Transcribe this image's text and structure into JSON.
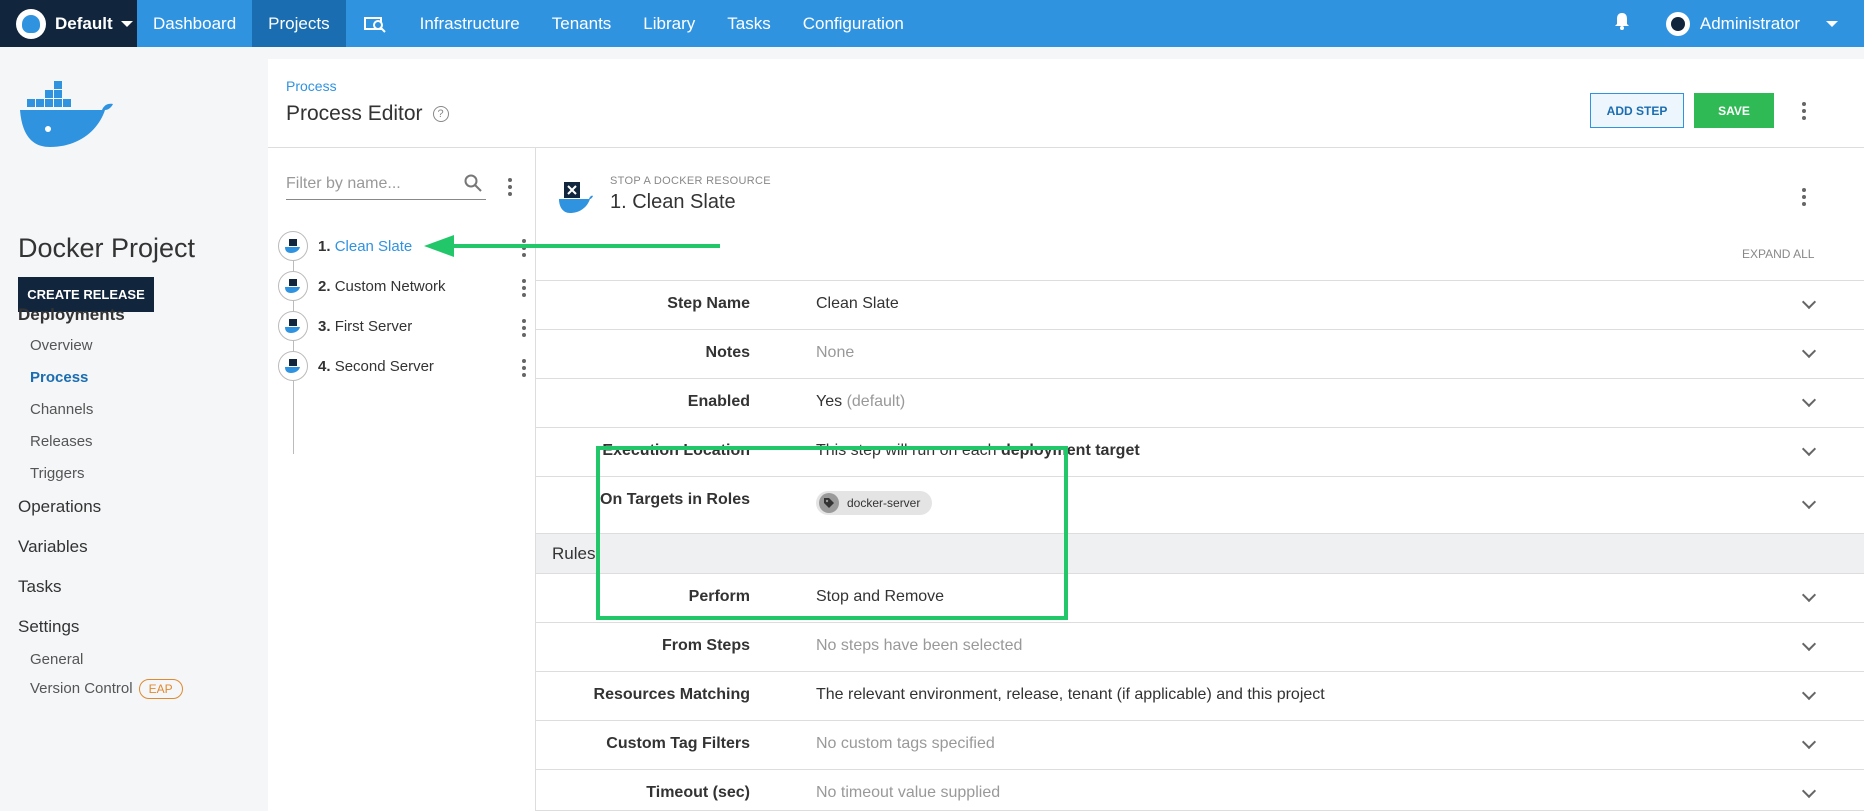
{
  "topnav": {
    "space": "Default",
    "items": [
      "Dashboard",
      "Projects",
      "Infrastructure",
      "Tenants",
      "Library",
      "Tasks",
      "Configuration"
    ],
    "user": "Administrator",
    "icons": {
      "logo": "octopus-logo-icon",
      "search": "search-machine-icon",
      "bell": "bell-icon",
      "avatar": "user-avatar-icon"
    }
  },
  "sidebar": {
    "project_title": "Docker Project",
    "create_release": "CREATE RELEASE",
    "deployments": "Deployments",
    "deployments_items": [
      "Overview",
      "Process",
      "Channels",
      "Releases",
      "Triggers"
    ],
    "operations": "Operations",
    "variables": "Variables",
    "tasks": "Tasks",
    "settings": "Settings",
    "settings_items": [
      "General",
      "Version Control"
    ],
    "eap_badge": "EAP"
  },
  "header": {
    "breadcrumb": "Process",
    "title": "Process Editor",
    "add_step": "ADD STEP",
    "save": "SAVE"
  },
  "steps": {
    "filter_placeholder": "Filter by name...",
    "items": [
      {
        "num": "1.",
        "name": "Clean Slate"
      },
      {
        "num": "2.",
        "name": "Custom Network"
      },
      {
        "num": "3.",
        "name": "First Server"
      },
      {
        "num": "4.",
        "name": "Second Server"
      }
    ]
  },
  "details": {
    "step_type": "STOP A DOCKER RESOURCE",
    "step_title": "1.  Clean Slate",
    "expand_all": "EXPAND ALL",
    "rows": {
      "step_name": {
        "label": "Step Name",
        "value": "Clean Slate"
      },
      "notes": {
        "label": "Notes",
        "value": "None"
      },
      "enabled": {
        "label": "Enabled",
        "value": "Yes",
        "suffix": "(default)"
      },
      "exec_loc": {
        "label": "Execution Location",
        "value_pre": "This step will run on each ",
        "value_bold": "deployment target"
      },
      "roles": {
        "label": "On Targets in Roles",
        "chip": "docker-server"
      },
      "rules_section": "Rules",
      "perform": {
        "label": "Perform",
        "value": "Stop and Remove"
      },
      "from_steps": {
        "label": "From Steps",
        "value": "No steps have been selected"
      },
      "resources": {
        "label": "Resources Matching",
        "value": "The relevant environment, release, tenant (if applicable) and this project"
      },
      "tag_filters": {
        "label": "Custom Tag Filters",
        "value": "No custom tags specified"
      },
      "timeout": {
        "label": "Timeout (sec)",
        "value": "No timeout value supplied"
      }
    }
  },
  "annotation": {
    "color": "#22c76a"
  },
  "colors": {
    "nav_blue": "#2f93e0",
    "nav_dark": "#11253d",
    "save_green": "#2fba55"
  }
}
